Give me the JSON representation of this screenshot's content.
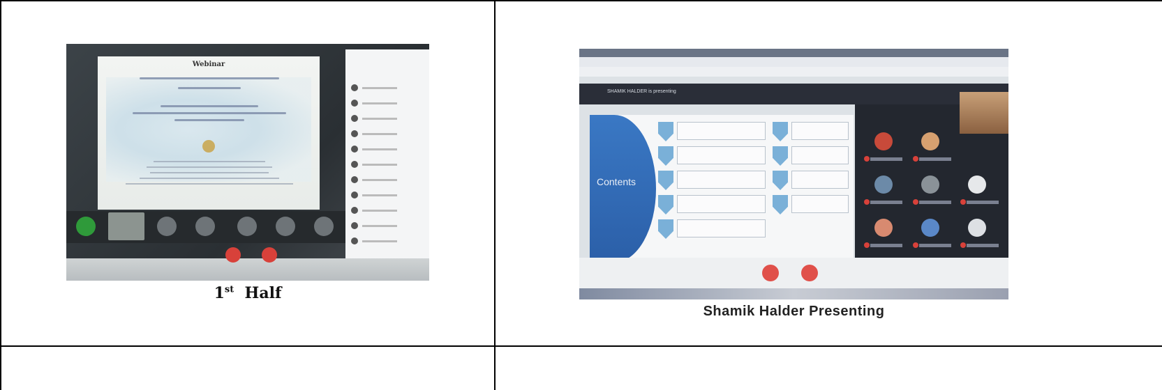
{
  "cells": [
    {
      "caption_main": "1",
      "caption_sup": "st",
      "caption_rest": "Half",
      "photo": {
        "slide_title": "Webinar"
      }
    },
    {
      "caption": "Shamik Halder Presenting",
      "photo": {
        "presenting_label": "SHAMIK HALDER is presenting",
        "slide_heading": "Contents"
      }
    }
  ]
}
